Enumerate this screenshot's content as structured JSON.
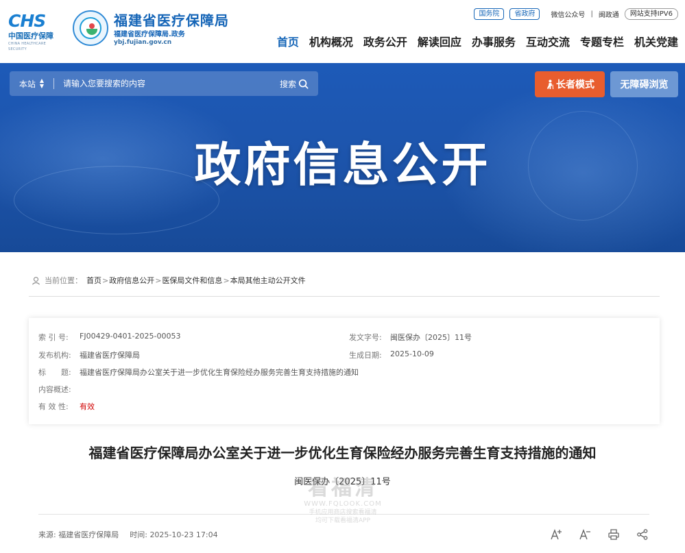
{
  "logo": {
    "chs_mark": "CHS",
    "chs_cn": "中国医疗保障",
    "chs_en": "CHINA HEALTHCARE SECURITY",
    "bureau_name": "福建省医疗保障局",
    "bureau_sub": "福建省医疗保障局.政务",
    "bureau_url": "ybj.fujian.gov.cn"
  },
  "top_links": {
    "state_council": "国务院",
    "province_gov": "省政府",
    "wechat": "微信公众号",
    "separator": "|",
    "min_zheng_tong": "闽政通",
    "ipv6": "网站支持IPV6"
  },
  "nav": [
    {
      "label": "首页",
      "active": true
    },
    {
      "label": "机构概况"
    },
    {
      "label": "政务公开"
    },
    {
      "label": "解读回应"
    },
    {
      "label": "办事服务"
    },
    {
      "label": "互动交流"
    },
    {
      "label": "专题专栏"
    },
    {
      "label": "机关党建"
    }
  ],
  "search": {
    "scope": "本站",
    "placeholder": "请输入您要搜索的内容",
    "button": "搜索"
  },
  "elder_mode": "长者模式",
  "accessible": "无障碍浏览",
  "banner_title": "政府信息公开",
  "breadcrumb": {
    "label": "当前位置：",
    "items": [
      "首页",
      "政府信息公开",
      "医保局文件和信息",
      "本局其他主动公开文件"
    ],
    "sep": ">"
  },
  "meta": {
    "index_no": {
      "k": "索 引 号:",
      "v": "FJ00429-0401-2025-00053"
    },
    "doc_no": {
      "k": "发文字号:",
      "v": "闽医保办〔2025〕11号"
    },
    "issuer": {
      "k": "发布机构:",
      "v": "福建省医疗保障局"
    },
    "date": {
      "k": "生成日期:",
      "v": "2025-10-09"
    },
    "title": {
      "k": "标　　题:",
      "v": "福建省医疗保障局办公室关于进一步优化生育保险经办服务完善生育支持措施的通知"
    },
    "summary": {
      "k": "内容概述:",
      "v": ""
    },
    "validity": {
      "k": "有 效 性:",
      "v": "有效"
    }
  },
  "doc": {
    "title": "福建省医疗保障局办公室关于进一步优化生育保险经办服务完善生育支持措施的通知",
    "number": "闽医保办〔2025〕11号",
    "source_label": "来源:",
    "source": "福建省医疗保障局",
    "time_label": "时间:",
    "time": "2025-10-23 17:04"
  },
  "watermark": {
    "big": "看福清",
    "url": "WWW.FQLOOK.COM",
    "line1": "手机应用商店搜索看福清",
    "line2": "均可下载看福清APP"
  }
}
